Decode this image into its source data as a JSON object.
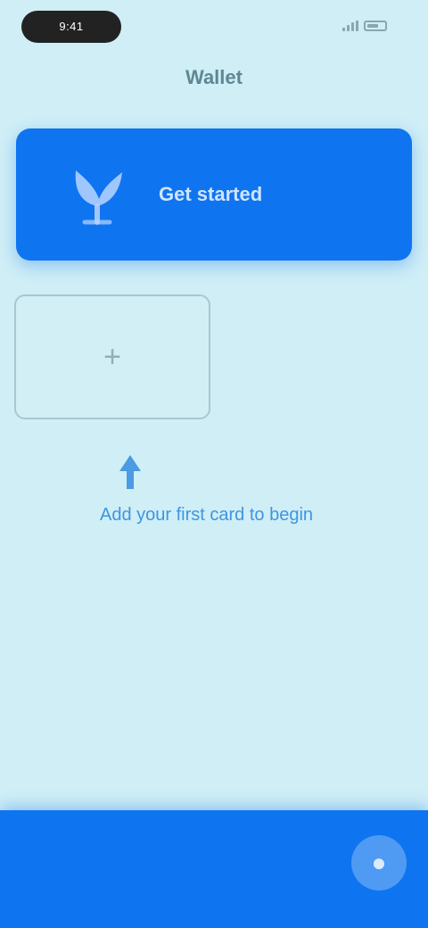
{
  "status_bar": {
    "time": "9:41",
    "signal_icon": "signal-icon",
    "battery_icon": "battery-icon"
  },
  "header": {
    "title": "Wallet"
  },
  "banner": {
    "icon": "leaf-icon",
    "text": "Get started"
  },
  "add_card": {
    "icon": "plus-icon",
    "glyph": "+"
  },
  "hint": {
    "icon": "arrow-up-icon",
    "text": "Add your first card to begin"
  },
  "bottom_bar": {
    "fab_icon": "person-icon",
    "fab_glyph": "●"
  },
  "colors": {
    "background": "#cfeef6",
    "accent": "#0f74f0",
    "hint": "#3f95e0"
  }
}
